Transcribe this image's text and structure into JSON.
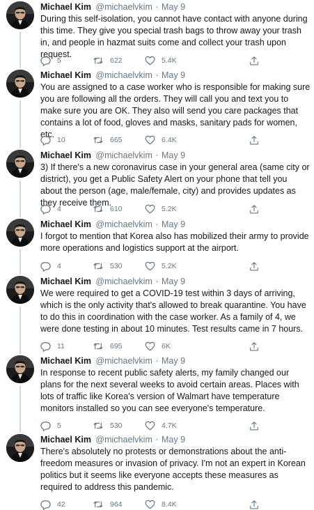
{
  "colors": {
    "text": "#14171a",
    "secondary": "#657786",
    "thread_line": "#cfd9de",
    "background": "#ffffff"
  },
  "icons": {
    "reply": "speech-bubble-icon",
    "retweet": "retweet-arrows-icon",
    "like": "heart-icon",
    "share": "share-arrow-icon",
    "avatar": "profile-photo"
  },
  "tweets": [
    {
      "name": "Michael Kim",
      "handle": "@michaelvkim",
      "separator": "·",
      "date": "May 9",
      "text": "During this self-isolation, you cannot have contact with anyone during this time. They give you special trash bags to throw away your trash in, and people in hazmat suits come and collect your trash upon request.",
      "replies": "5",
      "retweets": "622",
      "likes": "5.4K"
    },
    {
      "name": "Michael Kim",
      "handle": "@michaelvkim",
      "separator": "·",
      "date": "May 9",
      "text": "You are assigned to a case worker who is responsible for making sure you are following all the orders. They will call you and text you to make sure you are OK. They also will send you care packages that contains a lot of food, gloves and masks, sanitary pads for women, etc.",
      "replies": "10",
      "retweets": "665",
      "likes": "6.4K"
    },
    {
      "name": "Michael Kim",
      "handle": "@michaelvkim",
      "separator": "·",
      "date": "May 9",
      "text": "3) If there's a new coronavirus case in your general area (same city or district), you get a Public Safety Alert on your phone that tell you about the person (age, male/female, city) and provides updates as they receive them.",
      "replies": "4",
      "retweets": "610",
      "likes": "5.2K"
    },
    {
      "name": "Michael Kim",
      "handle": "@michaelvkim",
      "separator": "·",
      "date": "May 9",
      "text": "I forgot to mention that Korea also has mobilized their army to provide more operations and logistics support at the airport.",
      "replies": "4",
      "retweets": "530",
      "likes": "5.2K"
    },
    {
      "name": "Michael Kim",
      "handle": "@michaelvkim",
      "separator": "·",
      "date": "May 9",
      "text": "We were required to get a COVID-19 test within 3 days of arriving, which is the only activity that's allowed to break quarantine. You have to do this in coordination with the case worker. As a family of 4, we were done testing in about 10 minutes. Test results came in 7 hours.",
      "replies": "11",
      "retweets": "695",
      "likes": "6K"
    },
    {
      "name": "Michael Kim",
      "handle": "@michaelvkim",
      "separator": "·",
      "date": "May 9",
      "text": "In response to recent public safety alerts, my family changed our plans for the next several weeks to avoid certain areas. Places with lots of traffic like Korea's version of Walmart have temperature monitors installed so you can see everyone's temperature.",
      "replies": "5",
      "retweets": "530",
      "likes": "4.7K"
    },
    {
      "name": "Michael Kim",
      "handle": "@michaelvkim",
      "separator": "·",
      "date": "May 9",
      "text": "There's absolutely no protests or demonstrations about the anti-freedom measures or invasion of privacy. I'm not an expert in Korean politics but it seems like everyone accepts these measures as required to address this pandemic.",
      "replies": "42",
      "retweets": "964",
      "likes": "8.4K"
    }
  ]
}
